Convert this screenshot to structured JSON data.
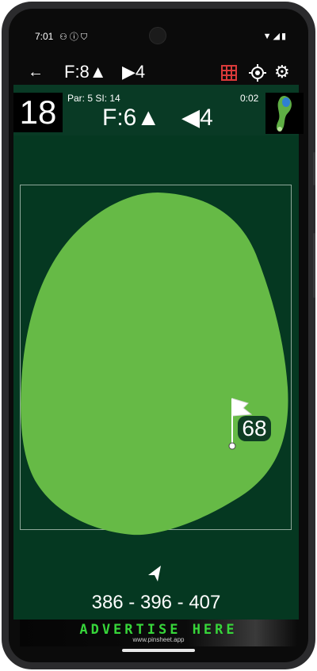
{
  "status_bar": {
    "time": "7:01",
    "left_icons": [
      "app-notification-icon",
      "info-icon",
      "shield-icon"
    ],
    "right_icons": [
      "wifi-icon",
      "signal-icon",
      "battery-icon"
    ]
  },
  "toolbar": {
    "front_label": "F:8▲",
    "next_label": "▶4",
    "grid_color": "#d93a3a"
  },
  "hole": {
    "number": "18",
    "par_si": "Par: 5  SI: 14",
    "timer": "0:02",
    "front_distance": "F:6▲",
    "prev_distance": "◀4"
  },
  "map": {
    "green_color": "#66ba46",
    "background_color": "#053821",
    "pin_distance": "68",
    "yardages": "386 - 396 - 407"
  },
  "ad": {
    "text": "ADVERTISE HERE",
    "url": "www.pinsheet.app"
  }
}
